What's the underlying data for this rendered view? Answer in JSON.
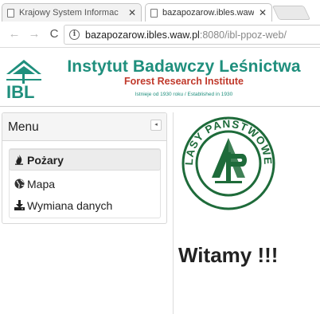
{
  "browser": {
    "tabs": [
      {
        "title": "Krajowy System Informac",
        "close": "✕"
      },
      {
        "title": "bazapozarow.ibles.waw.p",
        "close": "✕"
      }
    ],
    "nav": {
      "back": "←",
      "forward": "→",
      "reload": "C"
    },
    "address": {
      "host": "bazapozarow.ibles.waw.pl",
      "rest": ":8080/ibl-ppoz-web/"
    }
  },
  "header": {
    "logo_text": "IBL",
    "institute_name": "Instytut Badawczy Leśnictwa",
    "institute_subtitle": "Forest Research Institute",
    "established": "Istnieje od 1930 roku / Established in 1930"
  },
  "menu": {
    "title": "Menu",
    "collapse_icon": "◂",
    "items": [
      {
        "label": "Pożary",
        "icon": "fire-icon",
        "active": true
      },
      {
        "label": "Mapa",
        "icon": "globe-icon",
        "active": false
      },
      {
        "label": "Wymiana danych",
        "icon": "download-icon",
        "active": false
      }
    ]
  },
  "main": {
    "seal_text": "LASY PAŃSTWOWE",
    "welcome": "Witamy !!!"
  },
  "colors": {
    "brand_green": "#1f8f7d",
    "brand_red": "#c0392b",
    "seal_green": "#1e6b3a"
  }
}
